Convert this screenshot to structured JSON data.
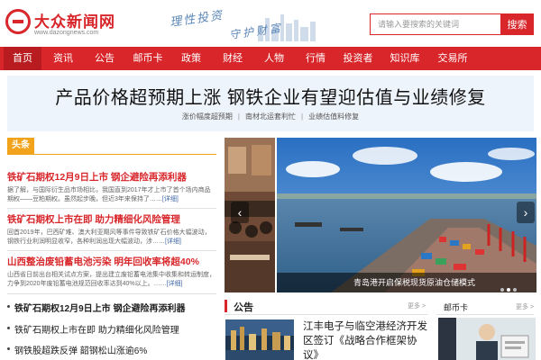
{
  "header": {
    "logo_text": "大众新闻网",
    "logo_domain": "www.dazongnews.com",
    "slogan_line1": "理性投资",
    "slogan_line2": "守护财富",
    "search_placeholder": "请输入要搜索的关键词",
    "search_button": "搜索"
  },
  "nav": {
    "items": [
      "首页",
      "资讯",
      "公告",
      "邮币卡",
      "政策",
      "财经",
      "人物",
      "行情",
      "投资者",
      "知识库",
      "交易所"
    ],
    "active": "首页"
  },
  "hero": {
    "title": "产品价格超预期上涨 钢铁企业有望迎估值与业绩修复",
    "links": [
      "涨价幅度超预期",
      "南材北运套利忙",
      "业绩估值料修复"
    ]
  },
  "headlines": {
    "label": "头条",
    "stories": [
      {
        "title": "铁矿石期权12月9日上市 钢企避险再添利器",
        "summary": "据了解，与国际衍生品市场相比，我国直到2017年才上市了首个场内商品期权——豆粕期权。虽然起步晚，但近3年来保持了……",
        "more": "[详细]"
      },
      {
        "title": "铁矿石期权上市在即 助力精细化风险管理",
        "summary": "回首2019年，巴西矿难、澳大利亚飓风等事件导致铁矿石价格大幅波动，钢铁行业利润明显收窄，各种利润出现大幅波动，涉……",
        "more": "[详细]"
      },
      {
        "title": "山西整治废铅蓄电池污染 明年回收率将超40%",
        "summary": "山西省日前出台相关试点方案，提出建立废铅蓄电池集中收集和转运制度，力争到2020年废铅蓄电池规范回收率达到40%以上。……",
        "more": "[详细]"
      }
    ],
    "list": [
      "铁矿石期权12月9日上市 钢企避险再添利器",
      "铁矿石期权上市在即 助力精细化风险管理",
      "钢铁股超跌反弹 韶钢松山涨逾6%"
    ]
  },
  "slider": {
    "caption": "青岛港开启保税现货原油仓储模式",
    "dots": 3,
    "active_dot": 1
  },
  "notice": {
    "label": "公告",
    "more": "更多 >",
    "text": "江丰电子与临空港经济开发区签订《战略合作框架协议》"
  },
  "card": {
    "label": "邮币卡",
    "more": "更多 >"
  },
  "colors": {
    "brand_red": "#d8262a",
    "headline_orange": "#f1a31b",
    "hero_bg": "#eef4fb"
  }
}
